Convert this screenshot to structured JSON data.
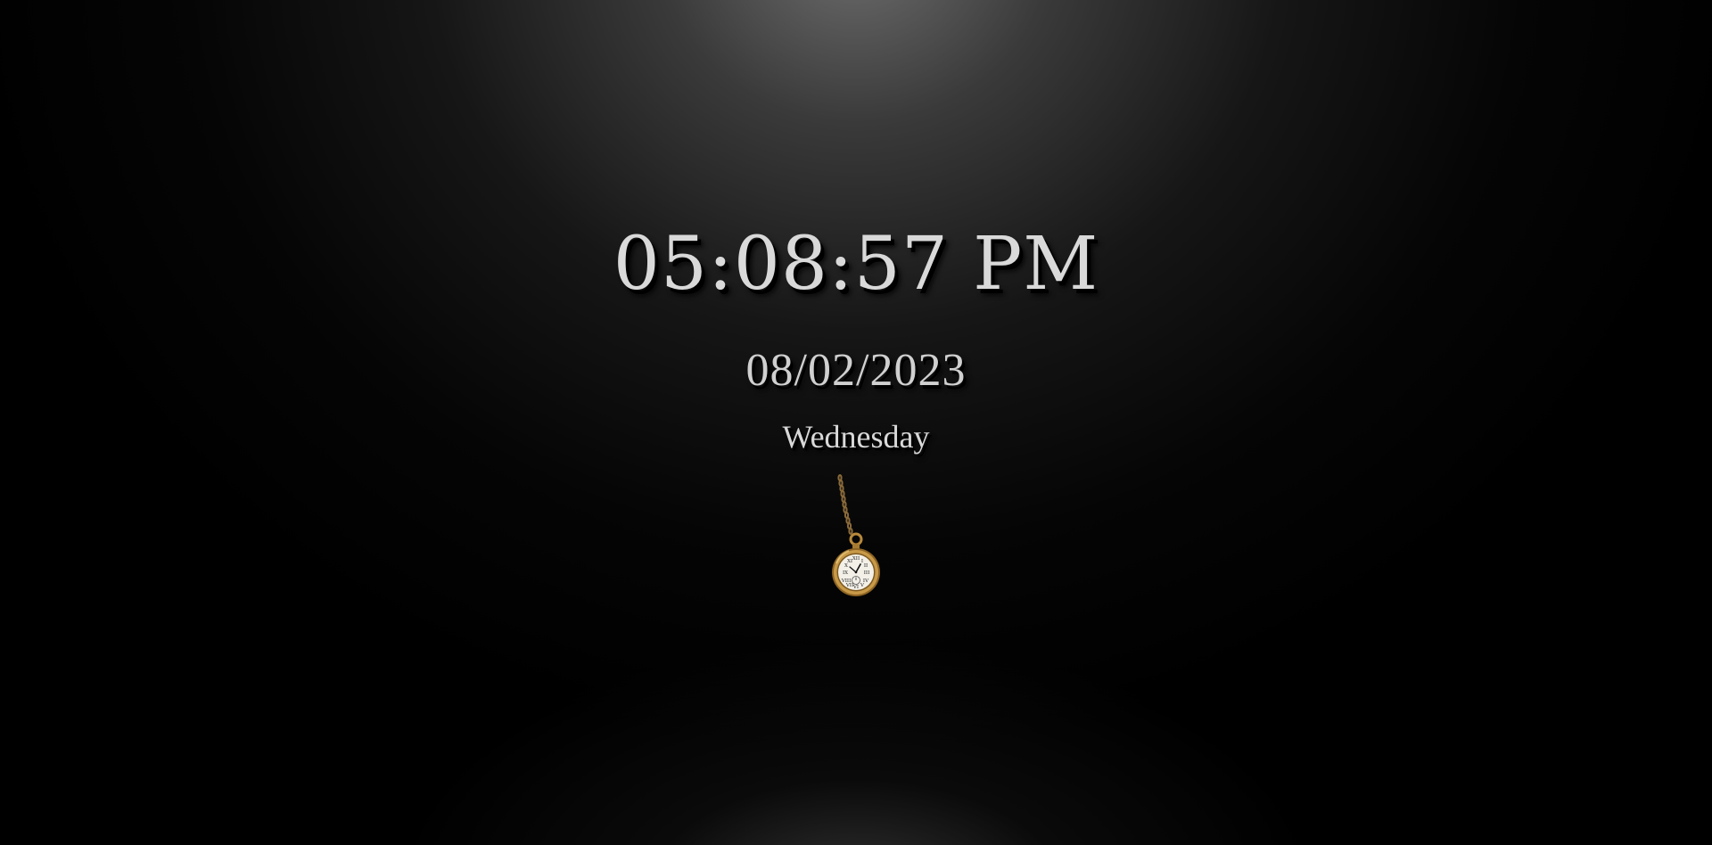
{
  "clock": {
    "time": "05:08:57 PM",
    "date": "08/02/2023",
    "day": "Wednesday"
  },
  "icons": {
    "pocket_watch": "pocket-watch-icon"
  },
  "colors": {
    "text": "#d9d9d9",
    "background": "#000000",
    "watch_gold": "#b8893b"
  }
}
